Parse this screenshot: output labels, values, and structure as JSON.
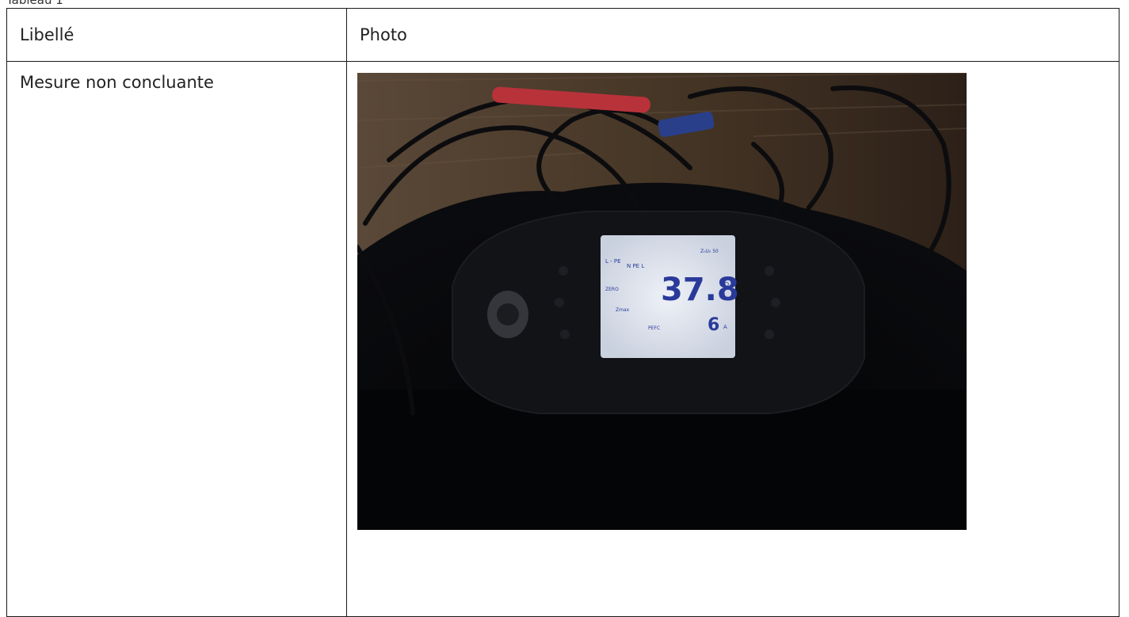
{
  "document": {
    "caption": "Tableau 1",
    "table": {
      "headers": [
        "Libellé",
        "Photo"
      ],
      "rows": [
        {
          "label": "Mesure non concluante",
          "photo": {
            "meter_display": {
              "mode": "L - PE",
              "terminals": "N PE L",
              "zero": "ZERO",
              "main_reading": "37.8",
              "main_unit": "Ω",
              "zmax_label": "Zmax",
              "pefc_label": "PEFC",
              "secondary_reading": "6",
              "secondary_unit": "A",
              "corner_label": "Z₀U₀ 50"
            },
            "colors": {
              "lcd_background": "#dfe4ee",
              "digit_color": "#2a3a9a",
              "cable_red": "#b8323a"
            }
          }
        }
      ]
    }
  }
}
